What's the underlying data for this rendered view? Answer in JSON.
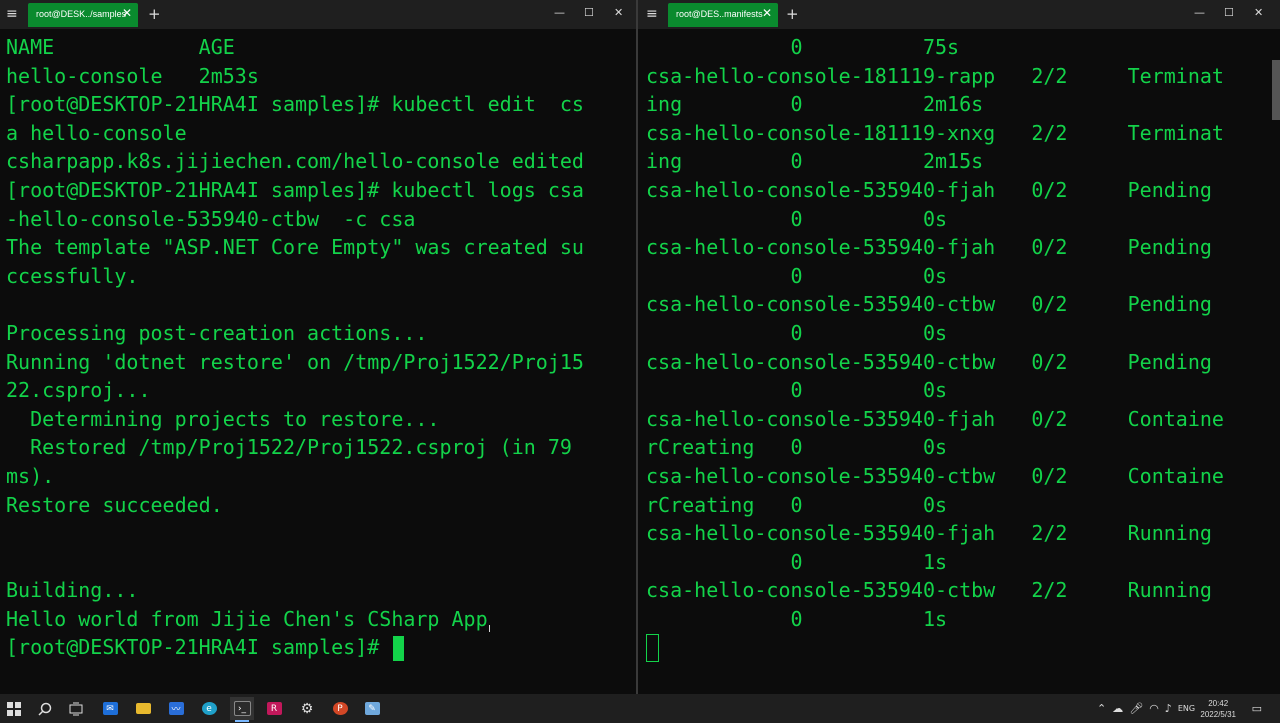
{
  "left_pane": {
    "tab_title": "root@DESK../samples",
    "lines": [
      "NAME            AGE",
      "hello-console   2m53s",
      "[root@DESKTOP-21HRA4I samples]# kubectl edit  cs",
      "a hello-console",
      "csharpapp.k8s.jijiechen.com/hello-console edited",
      "[root@DESKTOP-21HRA4I samples]# kubectl logs csa",
      "-hello-console-535940-ctbw  -c csa",
      "The template \"ASP.NET Core Empty\" was created su",
      "ccessfully.",
      "",
      "Processing post-creation actions...",
      "Running 'dotnet restore' on /tmp/Proj1522/Proj15",
      "22.csproj...",
      "  Determining projects to restore...",
      "  Restored /tmp/Proj1522/Proj1522.csproj (in 79",
      "ms).",
      "Restore succeeded.",
      "",
      "",
      "Building...",
      "Hello world from Jijie Chen's CSharp App"
    ],
    "prompt": "[root@DESKTOP-21HRA4I samples]# "
  },
  "right_pane": {
    "tab_title": "root@DES..manifests",
    "lines": [
      "            0          75s",
      "csa-hello-console-181119-rapp   2/2     Terminat",
      "ing         0          2m16s",
      "csa-hello-console-181119-xnxg   2/2     Terminat",
      "ing         0          2m15s",
      "csa-hello-console-535940-fjah   0/2     Pending",
      "            0          0s",
      "csa-hello-console-535940-fjah   0/2     Pending",
      "            0          0s",
      "csa-hello-console-535940-ctbw   0/2     Pending",
      "            0          0s",
      "csa-hello-console-535940-ctbw   0/2     Pending",
      "            0          0s",
      "csa-hello-console-535940-fjah   0/2     Containe",
      "rCreating   0          0s",
      "csa-hello-console-535940-ctbw   0/2     Containe",
      "rCreating   0          0s",
      "csa-hello-console-535940-fjah   2/2     Running",
      "            0          1s",
      "csa-hello-console-535940-ctbw   2/2     Running",
      "            0          1s"
    ]
  },
  "taskbar": {
    "tray_language": "ENG",
    "time": "20:42",
    "date": "2022/5/31"
  },
  "colors": {
    "terminal_text": "#13d34a",
    "tab_active": "#0a8a2e",
    "terminal_bg": "#0c0c0c",
    "taskbar_bg": "#1f1f1f"
  },
  "icons": [
    "windows-start-icon",
    "search-icon",
    "task-view-icon",
    "mail-icon",
    "file-explorer-icon",
    "whiteboard-icon",
    "edge-icon",
    "terminal-icon",
    "rider-icon",
    "settings-icon",
    "powerpoint-icon",
    "notepad-icon"
  ]
}
